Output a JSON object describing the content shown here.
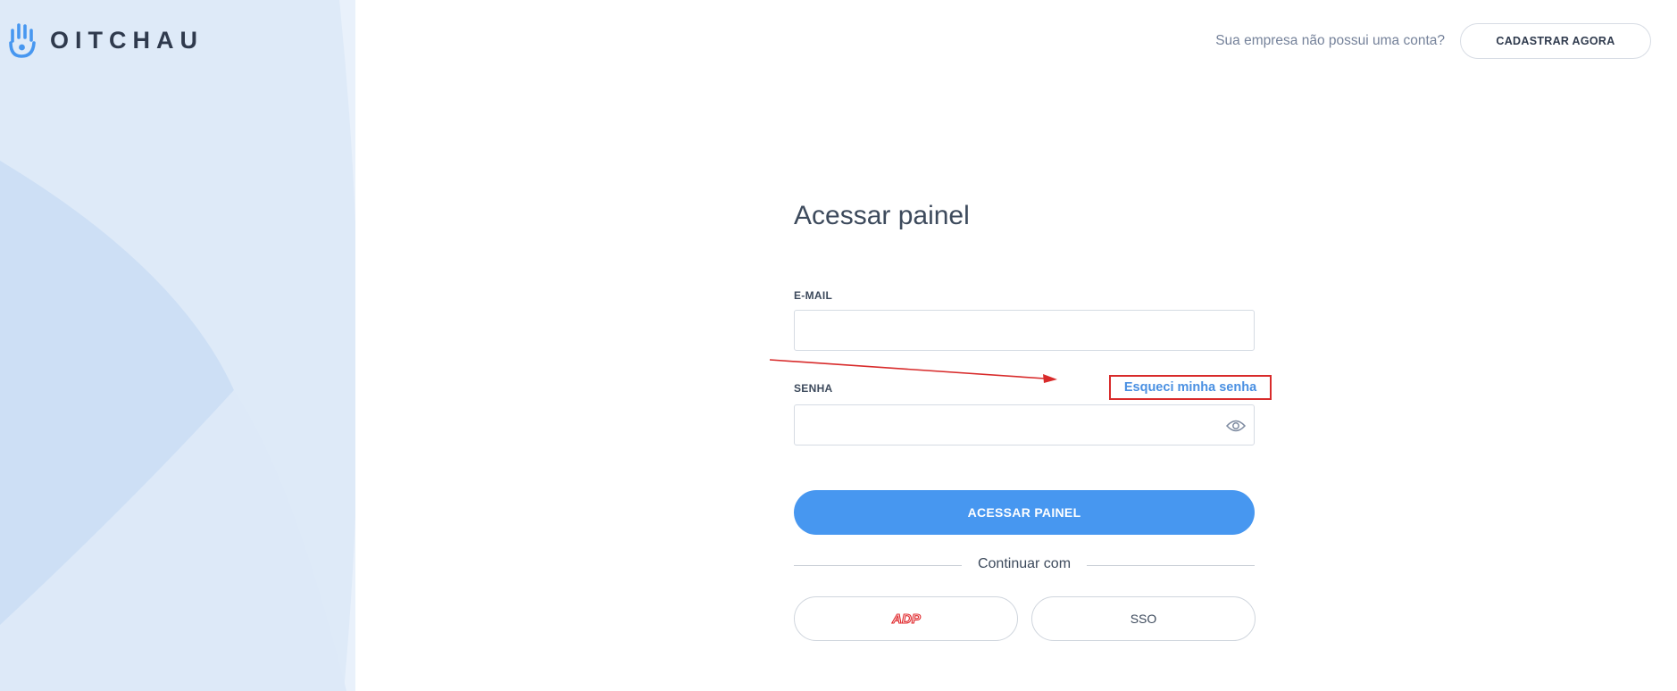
{
  "brand": {
    "name": "OITCHAU"
  },
  "header": {
    "question": "Sua empresa não possui uma conta?",
    "signup_label": "CADASTRAR AGORA"
  },
  "form": {
    "title": "Acessar painel",
    "email_label": "E-MAIL",
    "email_value": "",
    "password_label": "SENHA",
    "password_value": "",
    "forgot_label": "Esqueci minha senha",
    "submit_label": "ACESSAR PAINEL",
    "divider_label": "Continuar com",
    "adp_label": "ADP",
    "sso_label": "SSO"
  },
  "colors": {
    "primary": "#4797f0",
    "link": "#4a90e2",
    "annotation": "#d82b2b",
    "left_panel": "#e9f1fb"
  },
  "icons": [
    "hand-logo-icon",
    "eye-icon",
    "adp-logo-icon"
  ]
}
